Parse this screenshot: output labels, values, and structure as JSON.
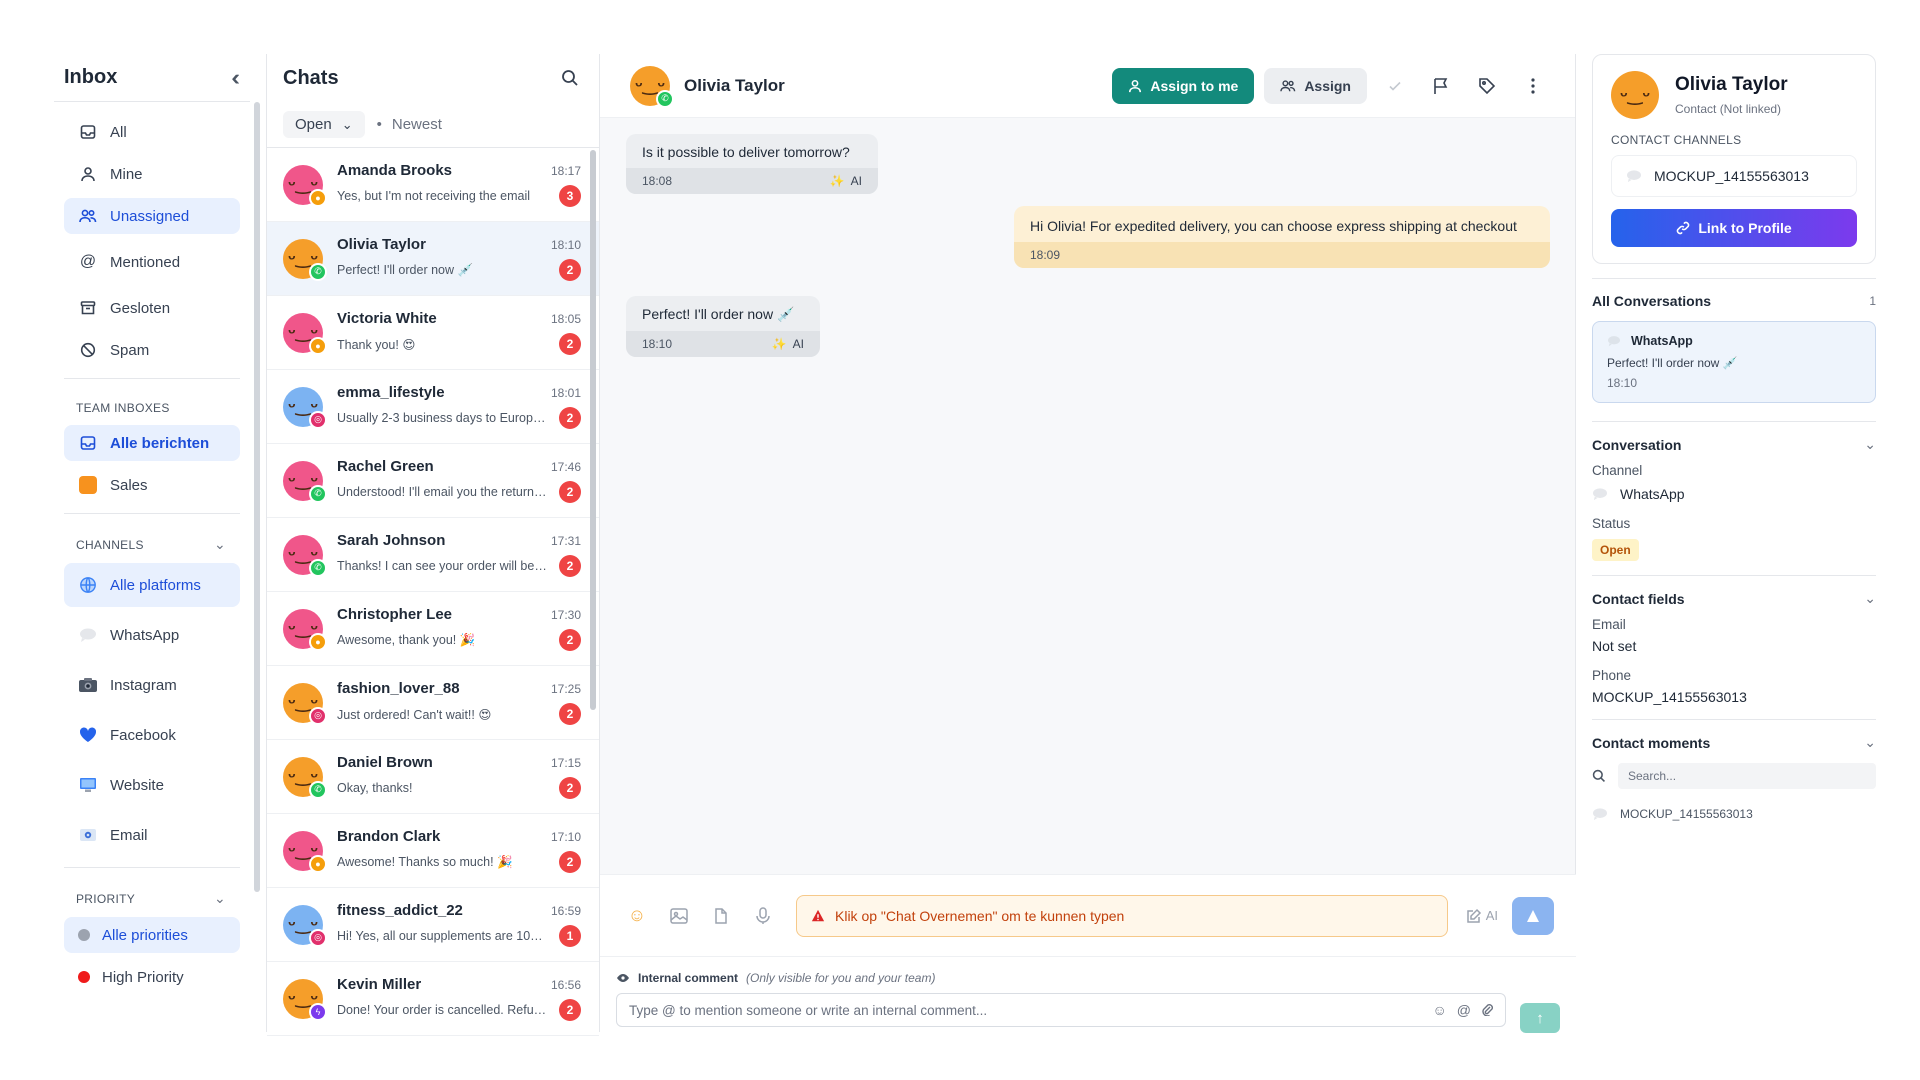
{
  "sidebar": {
    "title": "Inbox",
    "items": [
      {
        "label": "All",
        "icon": "inbox-icon"
      },
      {
        "label": "Mine",
        "icon": "user-icon"
      },
      {
        "label": "Unassigned",
        "icon": "users-icon",
        "active": true
      },
      {
        "label": "Mentioned",
        "icon": "at-icon"
      },
      {
        "label": "Gesloten",
        "icon": "archive-icon"
      },
      {
        "label": "Spam",
        "icon": "ban-icon"
      }
    ],
    "team_section": "TEAM INBOXES",
    "team_items": [
      {
        "label": "Alle berichten",
        "active": true
      },
      {
        "label": "Sales"
      }
    ],
    "channels_section": "CHANNELS",
    "channel_items": [
      {
        "label": "Alle platforms",
        "active": true
      },
      {
        "label": "WhatsApp"
      },
      {
        "label": "Instagram"
      },
      {
        "label": "Facebook"
      },
      {
        "label": "Website"
      },
      {
        "label": "Email"
      }
    ],
    "priority_section": "PRIORITY",
    "priority_items": [
      {
        "label": "Alle priorities",
        "active": true
      },
      {
        "label": "High Priority"
      }
    ]
  },
  "chatlist": {
    "title": "Chats",
    "filter": "Open",
    "sort": "Newest",
    "chats": [
      {
        "name": "Amanda Brooks",
        "time": "18:17",
        "preview": "Yes, but I'm not receiving the email",
        "count": "3",
        "avatar_color": "#f0568a",
        "channel": "widget"
      },
      {
        "name": "Olivia Taylor",
        "time": "18:10",
        "preview": "Perfect! I'll order now 💉",
        "count": "2",
        "avatar_color": "#f59e2a",
        "channel": "whatsapp",
        "active": true
      },
      {
        "name": "Victoria White",
        "time": "18:05",
        "preview": "Thank you! 😍",
        "count": "2",
        "avatar_color": "#f0568a",
        "channel": "widget"
      },
      {
        "name": "emma_lifestyle",
        "time": "18:01",
        "preview": "Usually 2-3 business days to Europe!...",
        "count": "2",
        "avatar_color": "#7cb3f2",
        "channel": "instagram"
      },
      {
        "name": "Rachel Green",
        "time": "17:46",
        "preview": "Understood! I'll email you the return ...",
        "count": "2",
        "avatar_color": "#f0568a",
        "channel": "whatsapp"
      },
      {
        "name": "Sarah Johnson",
        "time": "17:31",
        "preview": "Thanks! I can see your order will be s...",
        "count": "2",
        "avatar_color": "#f0568a",
        "channel": "whatsapp"
      },
      {
        "name": "Christopher Lee",
        "time": "17:30",
        "preview": "Awesome, thank you! 🎉",
        "count": "2",
        "avatar_color": "#f0568a",
        "channel": "widget"
      },
      {
        "name": "fashion_lover_88",
        "time": "17:25",
        "preview": "Just ordered! Can't wait!! 😍",
        "count": "2",
        "avatar_color": "#f59e2a",
        "channel": "instagram"
      },
      {
        "name": "Daniel Brown",
        "time": "17:15",
        "preview": "Okay, thanks!",
        "count": "2",
        "avatar_color": "#f59e2a",
        "channel": "whatsapp"
      },
      {
        "name": "Brandon Clark",
        "time": "17:10",
        "preview": "Awesome! Thanks so much! 🎉",
        "count": "2",
        "avatar_color": "#f0568a",
        "channel": "widget"
      },
      {
        "name": "fitness_addict_22",
        "time": "16:59",
        "preview": "Hi! Yes, all our supplements are 100...",
        "count": "1",
        "avatar_color": "#7cb3f2",
        "channel": "instagram"
      },
      {
        "name": "Kevin Miller",
        "time": "16:56",
        "preview": "Done! Your order is cancelled. Refun...",
        "count": "2",
        "avatar_color": "#f59e2a",
        "channel": "messenger"
      }
    ]
  },
  "conversation": {
    "name": "Olivia Taylor",
    "assign_me_label": "Assign to me",
    "assign_label": "Assign",
    "messages": [
      {
        "text": "Is it possible to deliver tomorrow?",
        "time": "18:08",
        "tag": "AI",
        "dir": "in"
      },
      {
        "text": "Hi Olivia! For expedited delivery, you can choose express shipping at checkout",
        "time": "18:09",
        "tag": "",
        "dir": "out"
      },
      {
        "text": "Perfect! I'll order now 💉",
        "time": "18:10",
        "tag": "AI",
        "dir": "in"
      }
    ],
    "composer_warning": "Klik op \"Chat Overnemen\" om te kunnen typen",
    "composer_ai": "AI",
    "internal_label": "Internal comment",
    "internal_hint": "(Only visible for you and your team)",
    "internal_placeholder": "Type @ to mention someone or write an internal comment..."
  },
  "contact": {
    "name": "Olivia Taylor",
    "subtitle": "Contact (Not linked)",
    "channels_label": "CONTACT CHANNELS",
    "channel_value": "MOCKUP_14155563013",
    "link_label": "Link to Profile",
    "all_conv_label": "All Conversations",
    "all_conv_count": "1",
    "conv_card": {
      "channel": "WhatsApp",
      "preview": "Perfect! I'll order now 💉",
      "time": "18:10"
    },
    "conversation_label": "Conversation",
    "channel_label": "Channel",
    "channel_name": "WhatsApp",
    "status_label": "Status",
    "status_value": "Open",
    "fields_label": "Contact fields",
    "email_label": "Email",
    "email_value": "Not set",
    "phone_label": "Phone",
    "phone_value": "MOCKUP_14155563013",
    "moments_label": "Contact moments",
    "moments_search": "Search...",
    "moment_item": "MOCKUP_14155563013"
  },
  "colors": {
    "primary_blue": "#1d4ed8",
    "teal": "#138a7c",
    "badge_red": "#ef4444",
    "whatsapp_green": "#22c55e"
  }
}
